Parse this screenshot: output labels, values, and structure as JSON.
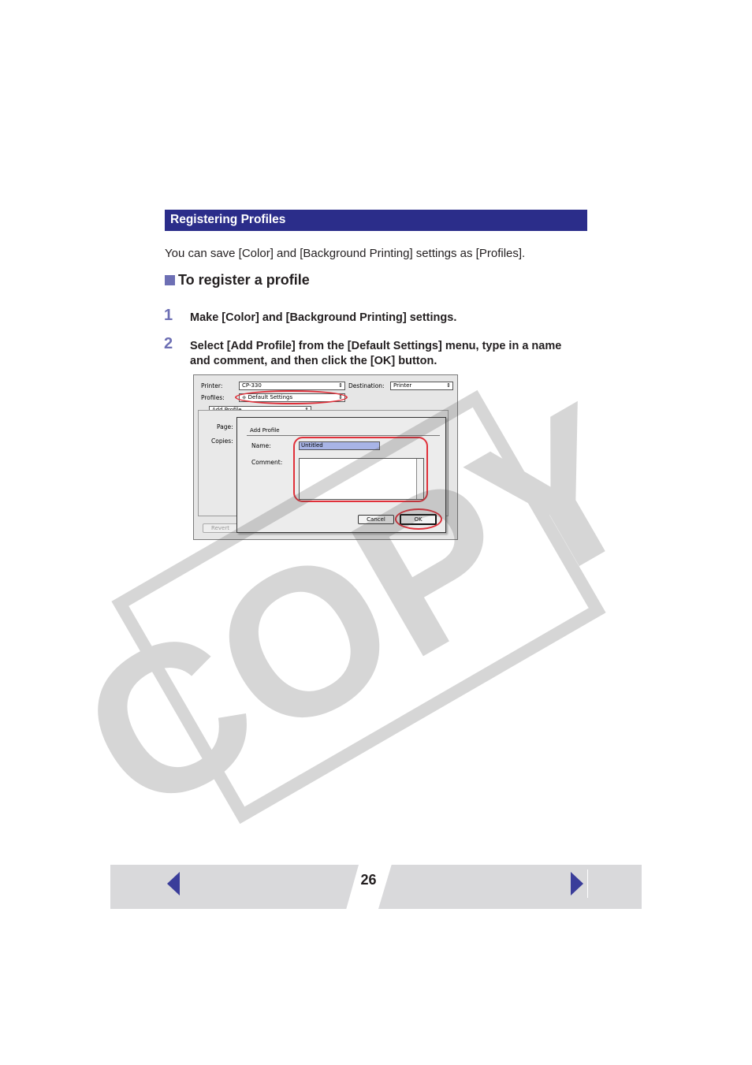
{
  "section": {
    "title": "Registering Profiles"
  },
  "intro": "You can save [Color] and [Background Printing] settings as [Profiles].",
  "subheading": "To register a profile",
  "steps": [
    {
      "number": "1",
      "text": "Make [Color] and [Background Printing] settings."
    },
    {
      "number": "2",
      "text": "Select [Add Profile] from the [Default Settings] menu, type in a name and comment, and then click the [OK] button."
    }
  ],
  "screenshot": {
    "printer_label": "Printer:",
    "printer_value": "CP-330",
    "destination_label": "Destination:",
    "destination_value": "Printer",
    "profiles_label": "Profiles:",
    "profiles_value": "Default Settings",
    "add_profile_menu": "Add Profile...",
    "page_label": "Page:",
    "copies_label": "Copies:",
    "revert_label": "Revert",
    "dialog_title": "Add Profile",
    "name_label": "Name:",
    "name_value": "Untitled",
    "comment_label": "Comment:",
    "cancel_label": "Cancel",
    "ok_label": "OK",
    "highlight_color": "#e0303a"
  },
  "watermark": "COPY",
  "footer": {
    "page_number": "26"
  },
  "colors": {
    "accent": "#2b2d8a",
    "step_number": "#6d6fb4",
    "nav_bar": "#d9d9db"
  }
}
